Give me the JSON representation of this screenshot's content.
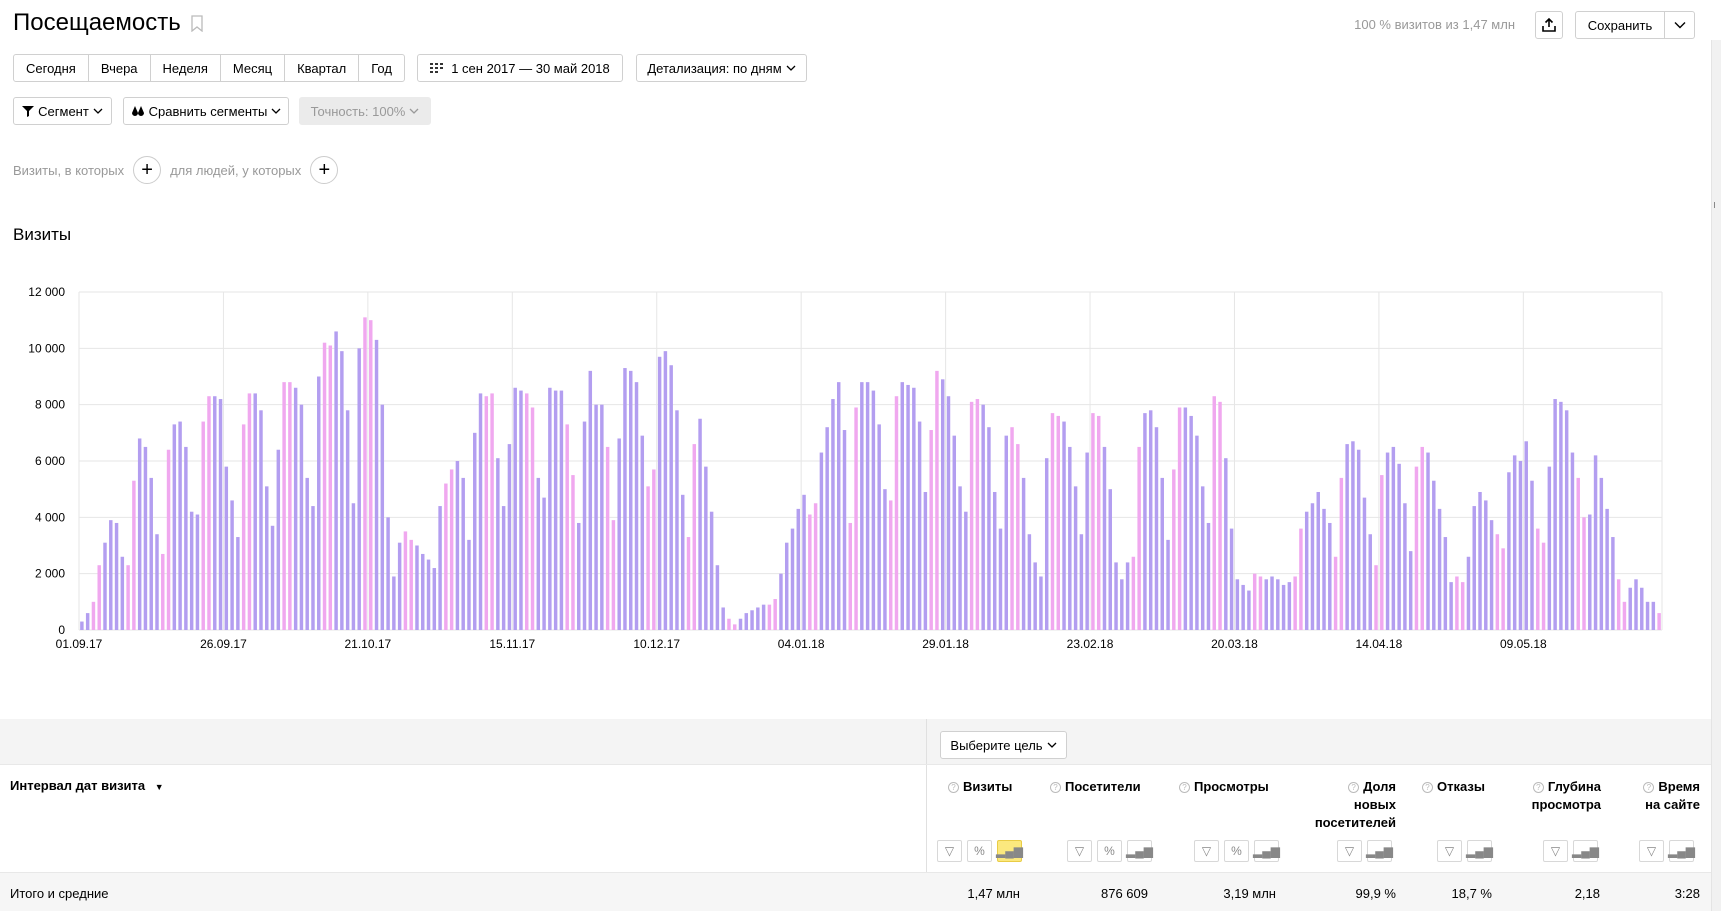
{
  "header": {
    "title": "Посещаемость",
    "visits_info": "100 % визитов из 1,47 млн",
    "save_label": "Сохранить"
  },
  "period": {
    "buttons": [
      "Сегодня",
      "Вчера",
      "Неделя",
      "Месяц",
      "Квартал",
      "Год"
    ],
    "date_range": "1 сен 2017 — 30 май 2018",
    "detail": "Детализация: по дням"
  },
  "segments": {
    "segment_label": "Сегмент",
    "compare_label": "Сравнить сегменты",
    "accuracy_label": "Точность: 100%"
  },
  "filters": {
    "visits_label": "Визиты, в которых",
    "people_label": "для людей, у которых"
  },
  "chart_title": "Визиты",
  "chart_data": {
    "type": "bar",
    "title": "Визиты",
    "ylim": [
      0,
      12000
    ],
    "y_ticks": [
      "0",
      "2 000",
      "4 000",
      "6 000",
      "8 000",
      "10 000",
      "12 000"
    ],
    "x_ticks": [
      "01.09.17",
      "26.09.17",
      "21.10.17",
      "15.11.17",
      "10.12.17",
      "04.01.18",
      "29.01.18",
      "23.02.18",
      "20.03.18",
      "14.04.18",
      "09.05.18"
    ],
    "x_ticks_weekend": [
      false,
      false,
      true,
      false,
      true,
      true,
      false,
      true,
      false,
      true,
      true
    ],
    "colors": {
      "weekday": "#b39ef0",
      "weekend": "#f0a8ef"
    },
    "grid": true,
    "values": [
      300,
      600,
      1000,
      2300,
      3100,
      3900,
      3800,
      2600,
      2300,
      5300,
      6800,
      6500,
      5400,
      3400,
      2700,
      6400,
      7300,
      7400,
      6500,
      4200,
      4100,
      7400,
      8300,
      8300,
      8200,
      5800,
      4600,
      3300,
      7300,
      8400,
      8400,
      7800,
      5100,
      3700,
      6400,
      8800,
      8800,
      8600,
      8000,
      5400,
      4400,
      9000,
      10200,
      10100,
      10600,
      9900,
      7800,
      4500,
      10000,
      11100,
      11000,
      10300,
      8000,
      4000,
      1900,
      3100,
      3500,
      3200,
      3000,
      2700,
      2500,
      2200,
      4400,
      5200,
      5700,
      6000,
      5400,
      3200,
      7000,
      8400,
      8300,
      8400,
      6100,
      4400,
      6600,
      8600,
      8500,
      8400,
      7900,
      5400,
      4700,
      8600,
      8500,
      8500,
      7300,
      5500,
      3800,
      7400,
      9200,
      8000,
      8000,
      6500,
      3900,
      6800,
      9300,
      9200,
      8800,
      6900,
      5100,
      5700,
      9700,
      9900,
      9400,
      7800,
      4800,
      3300,
      6600,
      7500,
      5800,
      4200,
      2300,
      800,
      400,
      200,
      400,
      600,
      700,
      800,
      900,
      900,
      1100,
      2000,
      3100,
      3600,
      4300,
      4800,
      4100,
      4500,
      6300,
      7200,
      8200,
      8800,
      7100,
      3800,
      7900,
      8800,
      8800,
      8500,
      7300,
      5000,
      4600,
      8300,
      8800,
      8700,
      8600,
      7400,
      4900,
      7100,
      9200,
      8900,
      8300,
      6900,
      5100,
      4200,
      8100,
      8200,
      8000,
      7200,
      4900,
      3600,
      6900,
      7200,
      6600,
      5400,
      3400,
      2400,
      1900,
      6100,
      7700,
      7600,
      7400,
      6500,
      5100,
      3400,
      6300,
      7700,
      7600,
      6500,
      5000,
      2400,
      1800,
      2400,
      2600,
      6500,
      7700,
      7800,
      7200,
      5400,
      3200,
      5700,
      7900,
      7900,
      7600,
      6900,
      5100,
      3800,
      8300,
      8100,
      6100,
      3600,
      1800,
      1600,
      1400,
      2000,
      1900,
      1800,
      1900,
      1800,
      1600,
      1700,
      1900,
      3600,
      4200,
      4500,
      4900,
      4300,
      3800,
      2600,
      5400,
      6600,
      6700,
      6400,
      4700,
      3400,
      2300,
      5500,
      6300,
      6500,
      5900,
      4500,
      2800,
      5800,
      6500,
      6300,
      5300,
      4300,
      3300,
      1700,
      1900,
      1700,
      2600,
      4400,
      4900,
      4600,
      3900,
      3400,
      2900,
      5600,
      6200,
      6000,
      6700,
      5300,
      3600,
      3100,
      5800,
      8200,
      8100,
      7800,
      6300,
      5400,
      4000,
      4100,
      6200,
      5400,
      4300,
      3300,
      1800,
      1000,
      1500,
      1800,
      1500,
      1000,
      1000,
      600
    ],
    "weekend": [
      false,
      false,
      true,
      true,
      false,
      false,
      false,
      false,
      true,
      true,
      false,
      false,
      false,
      false,
      true,
      true,
      false,
      false,
      false,
      false,
      false,
      true,
      true,
      false,
      false,
      false,
      false,
      false,
      true,
      true,
      false,
      false,
      false,
      false,
      false,
      true,
      true,
      false,
      false,
      false,
      false,
      false,
      true,
      true,
      false,
      false,
      false,
      false,
      false,
      true,
      true,
      false,
      false,
      false,
      false,
      false,
      true,
      true,
      false,
      false,
      false,
      false,
      false,
      true,
      true,
      false,
      false,
      false,
      false,
      false,
      true,
      true,
      false,
      false,
      false,
      false,
      false,
      true,
      true,
      false,
      false,
      false,
      false,
      false,
      true,
      true,
      false,
      false,
      false,
      false,
      false,
      true,
      true,
      false,
      false,
      false,
      false,
      false,
      true,
      true,
      false,
      false,
      false,
      false,
      false,
      true,
      true,
      false,
      false,
      false,
      false,
      false,
      true,
      true,
      false,
      false,
      false,
      false,
      false,
      true,
      true,
      false,
      false,
      false,
      false,
      false,
      true,
      true,
      false,
      false,
      false,
      false,
      false,
      true,
      true,
      false,
      false,
      false,
      false,
      false,
      true,
      true,
      false,
      false,
      false,
      false,
      false,
      true,
      true,
      false,
      false,
      false,
      false,
      false,
      true,
      true,
      false,
      false,
      false,
      false,
      false,
      true,
      true,
      false,
      false,
      false,
      false,
      false,
      true,
      true,
      false,
      false,
      false,
      false,
      false,
      true,
      true,
      false,
      false,
      false,
      false,
      false,
      true,
      true,
      false,
      false,
      false,
      false,
      false,
      true,
      true,
      false,
      false,
      false,
      false,
      false,
      true,
      true,
      false,
      false,
      false,
      false,
      false,
      true,
      true,
      false,
      false,
      false,
      false,
      false,
      true,
      true,
      false,
      false,
      false,
      false,
      false,
      true,
      true,
      false,
      false,
      false,
      false,
      false,
      true,
      true,
      false,
      false,
      false,
      false,
      false,
      true,
      true,
      false,
      false,
      false,
      false,
      false,
      true,
      true,
      false,
      false,
      false,
      false,
      false,
      true,
      true,
      false,
      false,
      false,
      false,
      false,
      true,
      true,
      false,
      false,
      false,
      false,
      false,
      true,
      true,
      false,
      false,
      false,
      false,
      false,
      true,
      true,
      false,
      false,
      false,
      false,
      false,
      true,
      true,
      false,
      false,
      false,
      false,
      false,
      true,
      true,
      false,
      false,
      false,
      false,
      false,
      true,
      true,
      false,
      false,
      false
    ]
  },
  "table": {
    "goal_button": "Выберите цель",
    "dimension_header": "Интервал дат визита",
    "columns": [
      {
        "key": "visits",
        "label": "Визиты",
        "total": "1,47 млн"
      },
      {
        "key": "users",
        "label": "Посетители",
        "total": "876 609"
      },
      {
        "key": "pageviews",
        "label": "Просмотры",
        "total": "3,19 млн"
      },
      {
        "key": "new_users",
        "label": "Доля новых посетителей",
        "total": "99,9 %"
      },
      {
        "key": "bounce",
        "label": "Отказы",
        "total": "18,7 %"
      },
      {
        "key": "depth",
        "label": "Глубина просмотра",
        "total": "2,18"
      },
      {
        "key": "time",
        "label": "Время на сайте",
        "total": "3:28"
      }
    ],
    "totals_label": "Итого и средние"
  }
}
